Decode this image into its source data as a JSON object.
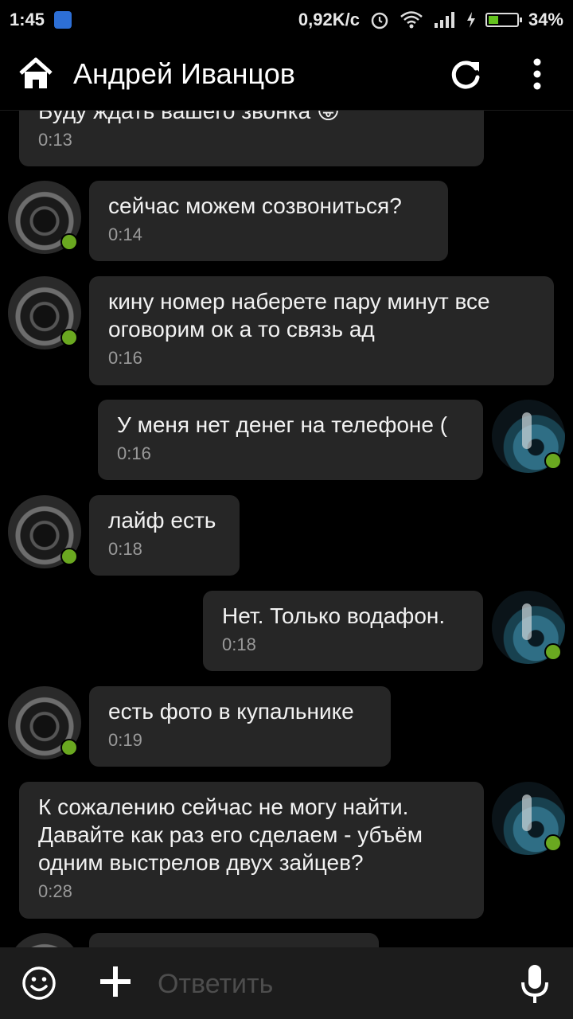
{
  "status_bar": {
    "time": "1:45",
    "network_speed": "0,92K/c",
    "battery_percent": "34%",
    "battery_level": 0.34
  },
  "header": {
    "contact_name": "Андрей Иванцов",
    "contact_online": true,
    "home_icon": "home-icon",
    "refresh_icon": "refresh-icon",
    "menu_icon": "more-vert-icon"
  },
  "messages": [
    {
      "side": "right",
      "text": "Буду ждать вашего звонка 😜",
      "time": "0:13"
    },
    {
      "side": "left",
      "text": "сейчас можем созвониться?",
      "time": "0:14"
    },
    {
      "side": "left",
      "text": "кину номер наберете пару минут все оговорим ок а то связь ад",
      "time": "0:16"
    },
    {
      "side": "right",
      "text": "У меня нет денег на телефоне (",
      "time": "0:16"
    },
    {
      "side": "left",
      "text": "лайф есть",
      "time": "0:18"
    },
    {
      "side": "right",
      "text": "Нет. Только водафон.",
      "time": "0:18"
    },
    {
      "side": "left",
      "text": "есть фото в купальнике",
      "time": "0:19"
    },
    {
      "side": "right",
      "text": "К сожалению сейчас не могу найти. Давайте как раз его сделаем - убъём одним выстрелов двух зайцев?",
      "time": "0:28"
    }
  ],
  "composer": {
    "placeholder": "Ответить",
    "emoji_icon": "emoji-icon",
    "attach_icon": "plus-icon",
    "mic_icon": "microphone-icon"
  },
  "colors": {
    "background": "#000000",
    "bubble": "#262626",
    "online": "#6aa820",
    "timestamp": "#9a9a9a"
  }
}
